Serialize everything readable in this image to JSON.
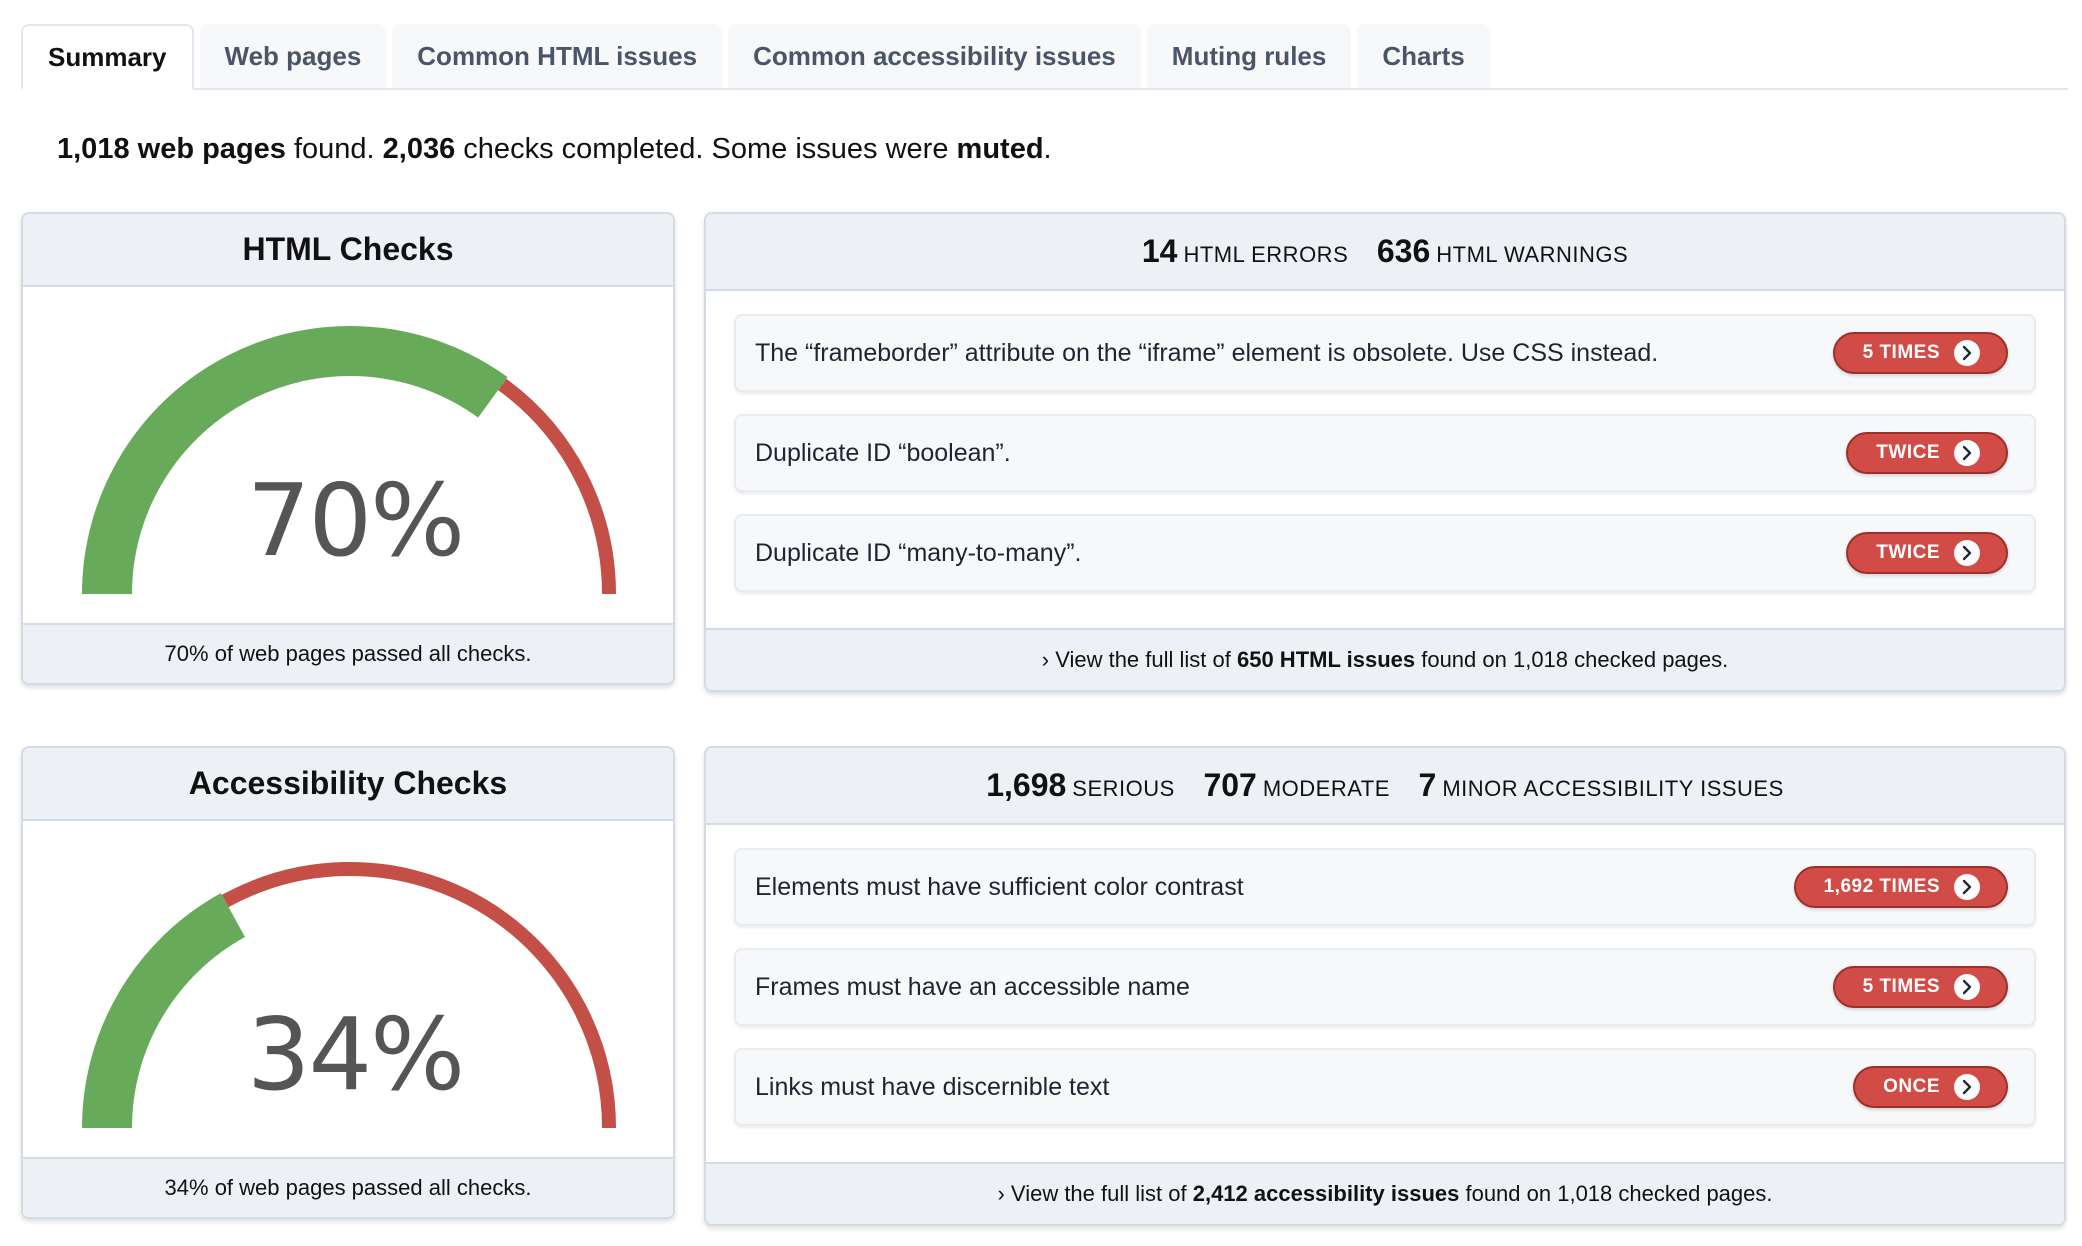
{
  "tabs": [
    {
      "label": "Summary",
      "active": true
    },
    {
      "label": "Web pages"
    },
    {
      "label": "Common HTML issues"
    },
    {
      "label": "Common accessibility issues"
    },
    {
      "label": "Muting rules"
    },
    {
      "label": "Charts"
    }
  ],
  "summary": {
    "pages_count": "1,018",
    "pages_label": "web pages",
    "found": " found. ",
    "checks_count": "2,036",
    "checks_label": " checks completed. Some issues were ",
    "muted": "muted",
    "end": "."
  },
  "html_checks": {
    "title": "HTML Checks",
    "percent_label": "70%",
    "pass_fraction": 0.7,
    "footer": "70% of web pages passed all checks.",
    "colors": {
      "pass": "#67ab5a",
      "fail": "#c44f46"
    }
  },
  "html_issues": {
    "errors_count": "14",
    "errors_label": "HTML ERRORS",
    "warnings_count": "636",
    "warnings_label": "HTML WARNINGS",
    "items": [
      {
        "text": "The “frameborder” attribute on the “iframe” element is obsolete. Use CSS instead.",
        "badge": "5 TIMES"
      },
      {
        "text": "Duplicate ID “boolean”.",
        "badge": "TWICE"
      },
      {
        "text": "Duplicate ID “many-to-many”.",
        "badge": "TWICE"
      }
    ],
    "footer": {
      "prefix": "› View the full list of ",
      "bold": "650 HTML issues",
      "suffix": " found on 1,018 checked pages."
    }
  },
  "a11y_checks": {
    "title": "Accessibility Checks",
    "percent_label": "34%",
    "pass_fraction": 0.34,
    "footer": "34% of web pages passed all checks.",
    "colors": {
      "pass": "#67ab5a",
      "fail": "#c44f46"
    }
  },
  "a11y_issues": {
    "serious_count": "1,698",
    "serious_label": "SERIOUS",
    "moderate_count": "707",
    "moderate_label": "MODERATE",
    "minor_count": "7",
    "minor_label": "MINOR ACCESSIBILITY ISSUES",
    "items": [
      {
        "text": "Elements must have sufficient color contrast",
        "badge": "1,692 TIMES"
      },
      {
        "text": "Frames must have an accessible name",
        "badge": "5 TIMES"
      },
      {
        "text": "Links must have discernible text",
        "badge": "ONCE"
      }
    ],
    "footer": {
      "prefix": "› View the full list of ",
      "bold": "2,412 accessibility issues",
      "suffix": " found on 1,018 checked pages."
    }
  }
}
